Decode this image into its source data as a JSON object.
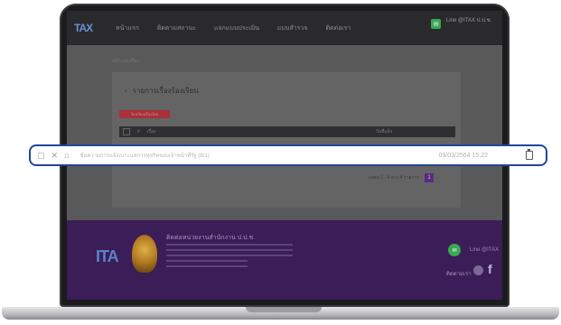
{
  "navbar": {
    "logo": "TAX",
    "items": [
      "หน้าแรก",
      "ติดตามสถานะ",
      "แจกแบบประเมิน",
      "แบบสำรวจ",
      "ติดต่อเรา"
    ],
    "line_text": "Line @ITAX ป.ป.ช."
  },
  "content": {
    "breadcrumb": "หน้าแรก/เรื่อง",
    "card_title": "รายการเรื่องร้องเรียน",
    "red_button": "ร้องเรียนเรื่องใหม่",
    "table_headers": [
      "#",
      "เรื่อง",
      "วันที่แจ้ง"
    ],
    "pagination_text": "แสดง 1 - 4 จาก 4 รายการ",
    "page_current": "1"
  },
  "footer": {
    "logo": "ITA",
    "title": "ติดต่อหน่วยงานสำนักงาน ป.ป.ช.",
    "line_text": "Line @ITAX",
    "follow_text": "ติดตามเรา",
    "fb_glyph": "f"
  },
  "address_bar": {
    "url": "ข้อความการแจ้งเบาะแสการทุจริตของเจ้าหน้าที่รัฐ (8/1)",
    "date": "09/03/2564 15:22"
  },
  "colors": {
    "address_border": "#20469a",
    "footer_bg": "#3b1d58",
    "line_green": "#3aa655",
    "red_button": "#a8313a"
  }
}
